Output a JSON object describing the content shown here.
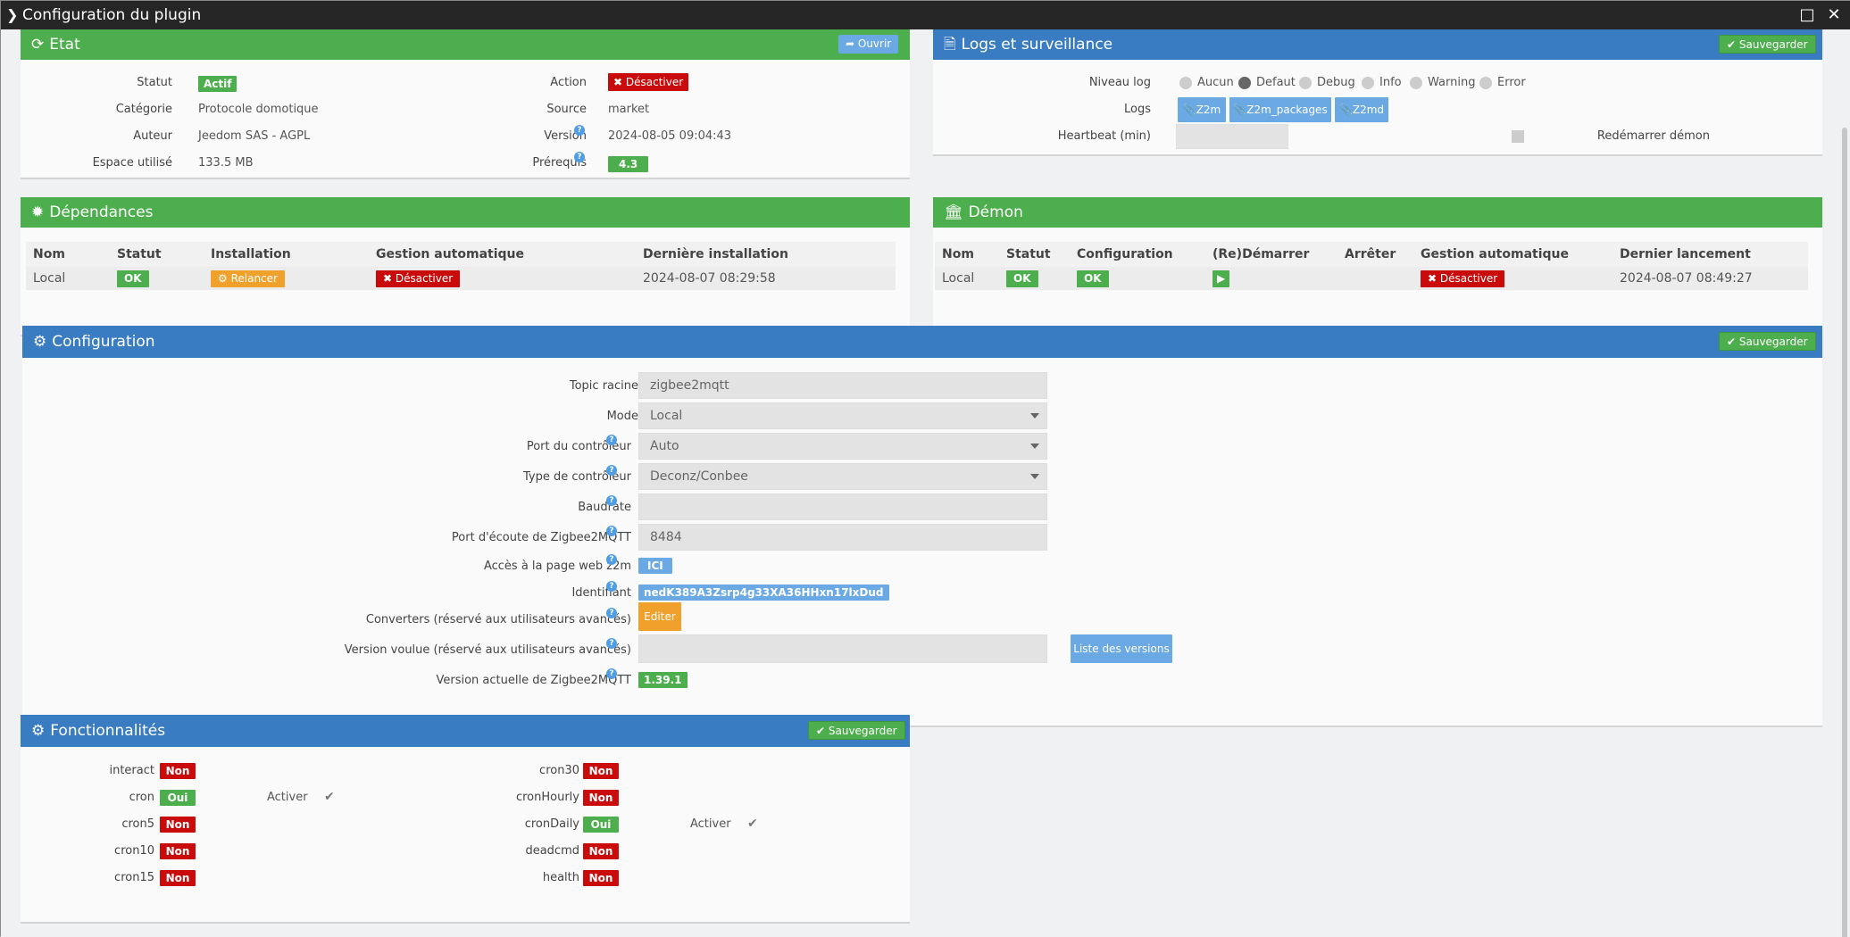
{
  "window": {
    "title": "Configuration du plugin"
  },
  "etat": {
    "title": "Etat",
    "open_label": "Ouvrir",
    "statut_label": "Statut",
    "statut_value": "Actif",
    "categorie_label": "Catégorie",
    "categorie_value": "Protocole domotique",
    "auteur_label": "Auteur",
    "auteur_value": "Jeedom SAS - AGPL",
    "espace_label": "Espace utilisé",
    "espace_value": "133.5 MB",
    "action_label": "Action",
    "action_value": "Désactiver",
    "source_label": "Source",
    "source_value": "market",
    "version_label": "Version",
    "version_value": "2024-08-05 09:04:43",
    "prerequis_label": "Prérequis",
    "prerequis_value": "4.3"
  },
  "logs": {
    "title": "Logs et surveillance",
    "save_label": "Sauvegarder",
    "niveau_label": "Niveau log",
    "levels": [
      "Aucun",
      "Defaut",
      "Debug",
      "Info",
      "Warning",
      "Error"
    ],
    "selected_level": "Defaut",
    "logs_label": "Logs",
    "log_buttons": [
      "Z2m",
      "Z2m_packages",
      "Z2md"
    ],
    "heartbeat_label": "Heartbeat (min)",
    "heartbeat_value": "",
    "restart_label": "Redémarrer démon"
  },
  "deps": {
    "title": "Dépendances",
    "headers": [
      "Nom",
      "Statut",
      "Installation",
      "Gestion automatique",
      "Dernière installation"
    ],
    "row": {
      "nom": "Local",
      "statut": "OK",
      "installation": "Relancer",
      "gestion": "Désactiver",
      "derniere": "2024-08-07 08:29:58"
    }
  },
  "demon": {
    "title": "Démon",
    "headers": [
      "Nom",
      "Statut",
      "Configuration",
      "(Re)Démarrer",
      "Arrêter",
      "Gestion automatique",
      "Dernier lancement"
    ],
    "row": {
      "nom": "Local",
      "statut": "OK",
      "configuration": "OK",
      "gestion": "Désactiver",
      "dernier": "2024-08-07 08:49:27"
    }
  },
  "config": {
    "title": "Configuration",
    "save_label": "Sauvegarder",
    "topic_label": "Topic racine",
    "topic_value": "zigbee2mqtt",
    "mode_label": "Mode",
    "mode_value": "Local",
    "port_label": "Port du contrôleur",
    "port_value": "Auto",
    "type_label": "Type de contrôleur",
    "type_value": "Deconz/Conbee",
    "baud_label": "Baudrate",
    "baud_value": "",
    "ecoute_label": "Port d'écoute de Zigbee2MQTT",
    "ecoute_value": "8484",
    "web_label": "Accès à la page web z2m",
    "web_value": "ICI",
    "ident_label": "Identifiant",
    "ident_value": "nedK389A3Zsrp4g33XA36HHxn17lxDud",
    "conv_label": "Converters (réservé aux utilisateurs avancés)",
    "conv_button": "Editer",
    "vv_label": "Version voulue (réservé aux utilisateurs avancés)",
    "vv_value": "",
    "vv_button": "Liste des versions",
    "va_label": "Version actuelle de Zigbee2MQTT",
    "va_value": "1.39.1"
  },
  "fonc": {
    "title": "Fonctionnalités",
    "save_label": "Sauvegarder",
    "activer_label": "Activer",
    "left": [
      {
        "name": "interact",
        "value": "Non"
      },
      {
        "name": "cron",
        "value": "Oui",
        "activer": true
      },
      {
        "name": "cron5",
        "value": "Non"
      },
      {
        "name": "cron10",
        "value": "Non"
      },
      {
        "name": "cron15",
        "value": "Non"
      }
    ],
    "right": [
      {
        "name": "cron30",
        "value": "Non"
      },
      {
        "name": "cronHourly",
        "value": "Non"
      },
      {
        "name": "cronDaily",
        "value": "Oui",
        "activer": true
      },
      {
        "name": "deadcmd",
        "value": "Non"
      },
      {
        "name": "health",
        "value": "Non"
      }
    ]
  }
}
